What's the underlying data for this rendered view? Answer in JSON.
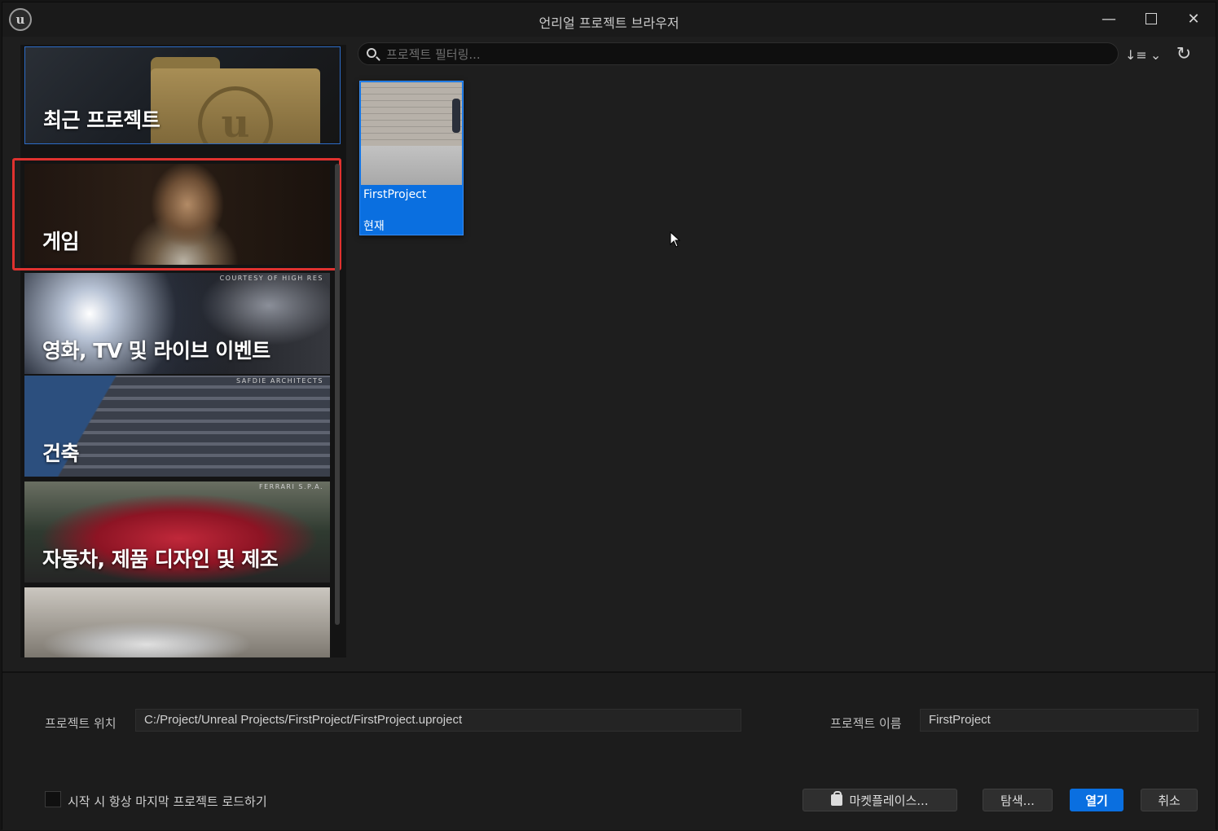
{
  "window": {
    "title": "언리얼 프로젝트 브라우저",
    "logo_glyph": "u",
    "controls": {
      "minimize": "—",
      "close": "✕"
    }
  },
  "categories": [
    {
      "id": "recent",
      "label": "최근 프로젝트",
      "credit": ""
    },
    {
      "id": "game",
      "label": "게임",
      "credit": ""
    },
    {
      "id": "film",
      "label": "영화, TV 및 라이브 이벤트",
      "credit": "COURTESY OF HIGH RES"
    },
    {
      "id": "arch",
      "label": "건축",
      "credit": "SAFDIE ARCHITECTS"
    },
    {
      "id": "auto",
      "label": "자동차, 제품 디자인 및 제조",
      "credit": "FERRARI S.P.A."
    },
    {
      "id": "aero",
      "label": "",
      "credit": ""
    }
  ],
  "search": {
    "placeholder": "프로젝트 필터링..."
  },
  "toolbar": {
    "sort_glyph": "↓≡",
    "sort_chevron": "⌄",
    "refresh_glyph": "↻"
  },
  "projects": [
    {
      "name": "FirstProject",
      "status": "현재"
    }
  ],
  "footer": {
    "location_label": "프로젝트 위치",
    "location_value": "C:/Project/Unreal Projects/FirstProject/FirstProject.uproject",
    "name_label": "프로젝트 이름",
    "name_value": "FirstProject",
    "autoload_label": "시작 시 항상 마지막 프로젝트 로드하기",
    "marketplace_label": "마켓플레이스...",
    "browse_label": "탐색...",
    "open_label": "열기",
    "cancel_label": "취소"
  },
  "colors": {
    "accent": "#0a6fe0",
    "highlight": "#e0322f",
    "background": "#1e1e1e"
  },
  "icons": [
    "unreal-logo-icon",
    "minimize-icon",
    "maximize-icon",
    "close-icon",
    "search-icon",
    "sort-icon",
    "refresh-icon",
    "marketplace-bag-icon",
    "mouse-cursor-icon"
  ]
}
